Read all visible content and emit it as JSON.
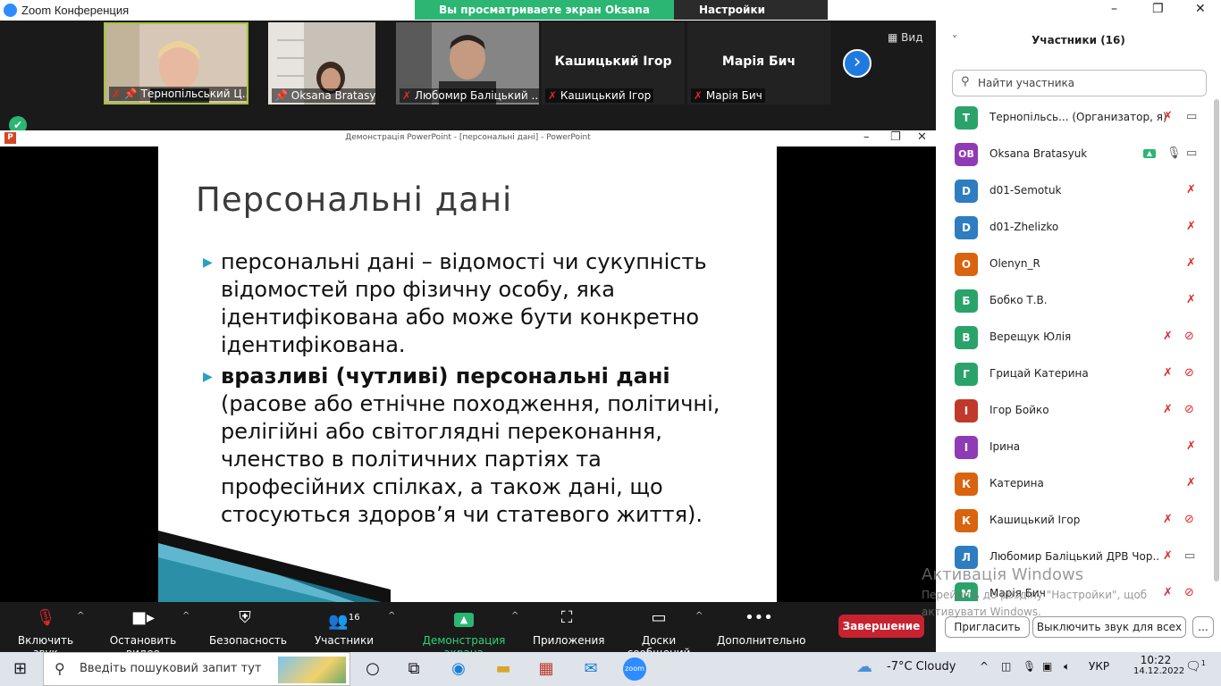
{
  "window": {
    "title": "Zoom Конференция"
  },
  "banner": {
    "share_text": "Вы просматриваете экран Oksana Bratasyuk",
    "view_options": "Настройки просмотра"
  },
  "video_strip": {
    "tiles": [
      {
        "name": "Тернопільський Ц..."
      },
      {
        "name": "Oksana Bratasyuk"
      },
      {
        "name": "Любомир Баліцький ..."
      },
      {
        "big_name": "Кашицький Ігор",
        "name": "Кашицький Ігор"
      },
      {
        "big_name": "Марія Бич",
        "name": "Марія Бич"
      }
    ],
    "view_label": "Вид"
  },
  "ppt": {
    "title": "Демонстрація PowerPoint - [персональні дані] - PowerPoint",
    "app_letter": "P"
  },
  "slide": {
    "heading": "Персональні дані",
    "b1": "персональні дані – відомості чи сукупність відомостей про фізичну особу, яка ідентифікована або може бути конкретно ідентифікована.",
    "b2_bold": "вразливі (чутливі) персональні дані",
    "b2_rest": " (расове або етнічне походження, політичні, релігійні або світоглядні переконання, членство в політичних партіях та професійних спілках, а також дані, що стосуються здоров’я чи статевого життя)."
  },
  "toolbar": {
    "mute": "Включить звук",
    "video": "Остановить видео",
    "security": "Безопасность",
    "participants": "Участники",
    "participants_count": "16",
    "share": "Демонстрация экрана",
    "apps": "Приложения",
    "whiteboard": "Доски сообщений",
    "more": "Дополнительно",
    "end": "Завершение"
  },
  "panel": {
    "title": "Участники (16)",
    "search_placeholder": "Найти участника",
    "participants": [
      {
        "initial": "Т",
        "name": "Тернопільсь... (Организатор, я)",
        "color": "#2aa36b"
      },
      {
        "initial": "OB",
        "name": "Oksana Bratasyuk",
        "color": "#8e3bb5"
      },
      {
        "initial": "D",
        "name": "d01-Semotuk",
        "color": "#2d7dc0"
      },
      {
        "initial": "D",
        "name": "d01-Zhelizko",
        "color": "#2d7dc0"
      },
      {
        "initial": "O",
        "name": "Olenyn_R",
        "color": "#d9630f"
      },
      {
        "initial": "Б",
        "name": "Бобко Т.В.",
        "color": "#2aa36b"
      },
      {
        "initial": "В",
        "name": "Верещук Юлія",
        "color": "#2aa36b"
      },
      {
        "initial": "Г",
        "name": "Грицай Катерина",
        "color": "#2aa36b"
      },
      {
        "initial": "І",
        "name": "Ігор Бойко",
        "color": "#c0392b"
      },
      {
        "initial": "І",
        "name": "Ірина",
        "color": "#8e3bb5"
      },
      {
        "initial": "К",
        "name": "Катерина",
        "color": "#d9630f"
      },
      {
        "initial": "К",
        "name": "Кашицький Ігор",
        "color": "#d9630f"
      },
      {
        "initial": "Л",
        "name": "Любомир Баліцький ДРВ Чор...",
        "color": "#2d7dc0"
      },
      {
        "initial": "М",
        "name": "Марія Бич",
        "color": "#2aa36b"
      }
    ],
    "invite": "Пригласить",
    "mute_all": "Выключить звук для всех",
    "more": "..."
  },
  "watermark": {
    "line1": "Активація Windows",
    "line2": "Перейдіть до розділу \"Настройки\", щоб",
    "line3": "активувати Windows."
  },
  "taskbar": {
    "search_placeholder": "Введіть пошуковий запит тут",
    "weather": "-7°C  Cloudy",
    "lang": "УКР",
    "time": "10:22",
    "date": "14.12.2022",
    "notifications": "1",
    "zoom_label": "zoom"
  }
}
